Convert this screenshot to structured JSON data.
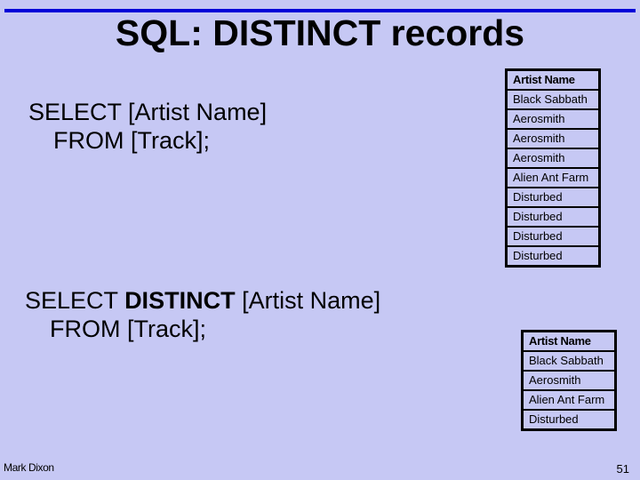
{
  "slide": {
    "title": "SQL: DISTINCT records",
    "accent_color": "#0000d8",
    "background_color": "#c6c8f4"
  },
  "query1": {
    "line1": "SELECT [Artist Name]",
    "line2": "FROM [Track];"
  },
  "query2": {
    "select": "SELECT ",
    "keyword": "DISTINCT",
    "rest": " [Artist Name]",
    "line2": "FROM [Track];"
  },
  "table1": {
    "header": "Artist Name",
    "rows": [
      "Black Sabbath",
      "Aerosmith",
      "Aerosmith",
      "Aerosmith",
      "Alien Ant Farm",
      "Disturbed",
      "Disturbed",
      "Disturbed",
      "Disturbed"
    ]
  },
  "table2": {
    "header": "Artist Name",
    "rows": [
      "Black Sabbath",
      "Aerosmith",
      "Alien Ant Farm",
      "Disturbed"
    ]
  },
  "footer": {
    "author": "Mark Dixon",
    "page_number": "51"
  }
}
